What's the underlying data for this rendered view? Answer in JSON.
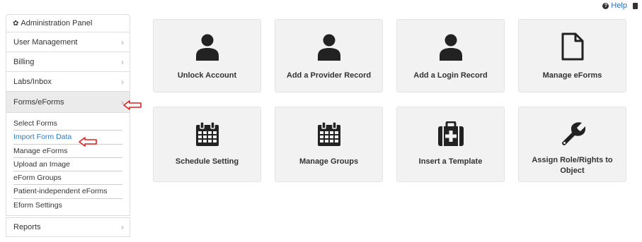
{
  "topbar": {
    "help_label": "Help"
  },
  "sidebar": {
    "header": "Administration Panel",
    "items": [
      {
        "label": "User Management"
      },
      {
        "label": "Billing"
      },
      {
        "label": "Labs/Inbox"
      },
      {
        "label": "Forms/eForms"
      }
    ],
    "submenu": [
      {
        "label": "Select Forms"
      },
      {
        "label": "Import Form Data"
      },
      {
        "label": "Manage eForms"
      },
      {
        "label": "Upload an Image"
      },
      {
        "label": "eForm Groups"
      },
      {
        "label": "Patient-independent eForms"
      },
      {
        "label": "Eform Settings"
      }
    ],
    "last_item": {
      "label": "Reports"
    }
  },
  "tiles": [
    {
      "label": "Unlock Account",
      "icon": "user-icon"
    },
    {
      "label": "Add a Provider Record",
      "icon": "user-icon"
    },
    {
      "label": "Add a Login Record",
      "icon": "user-icon"
    },
    {
      "label": "Manage eForms",
      "icon": "file-icon"
    },
    {
      "label": "Schedule Setting",
      "icon": "calendar-icon"
    },
    {
      "label": "Manage Groups",
      "icon": "calendar-icon"
    },
    {
      "label": "Insert a Template",
      "icon": "medkit-icon"
    },
    {
      "label": "Assign Role/Rights to Object",
      "icon": "wrench-icon"
    }
  ],
  "colors": {
    "link": "#2a7ac8",
    "arrow": "#e02020",
    "tile_bg": "#f2f2f2"
  }
}
